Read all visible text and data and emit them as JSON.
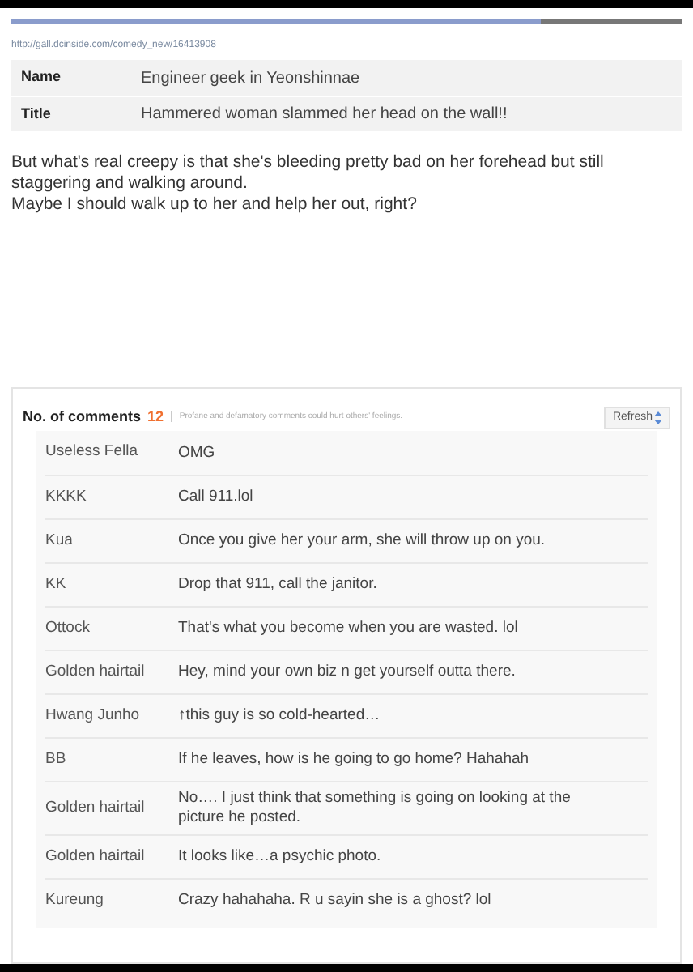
{
  "load_bar": {
    "level": 0.79
  },
  "url": "http://gall.dcinside.com/comedy_new/16413908",
  "post_info": [
    {
      "label": "Name",
      "value": "Engineer geek in Yeonshinnae"
    },
    {
      "label": "Title",
      "value": "Hammered woman slammed her head on the wall!!"
    }
  ],
  "body": [
    "But what's real creepy is that she's bleeding pretty bad on her forehead but still staggering and walking around.",
    "Maybe I should walk up to her and help her out, right?"
  ],
  "comments_header": {
    "label": "No. of comments",
    "count": "12",
    "separator": "|",
    "notice": "Profane and defamatory comments could hurt others' feelings.",
    "refresh": "Refresh"
  },
  "comments": [
    {
      "author": "Useless Fella",
      "text": "OMG"
    },
    {
      "author": "KKKK",
      "text": "Call 911.lol"
    },
    {
      "author": "Kua",
      "text": "Once you give her your arm, she will throw up on you."
    },
    {
      "author": "KK",
      "text": "Drop that 911, call the janitor."
    },
    {
      "author": "Ottock",
      "text": "That's what you become when you are wasted. lol"
    },
    {
      "author": "Golden hairtail",
      "text": "Hey, mind your own biz n get yourself outta there."
    },
    {
      "author": "Hwang Junho",
      "text": "↑this guy is so cold-hearted…"
    },
    {
      "author": "BB",
      "text": "If he leaves, how is he going to go home? Hahahah"
    },
    {
      "author": "Golden hairtail",
      "text": "No…. I just think that something is going on looking at the picture he posted."
    },
    {
      "author": "Golden hairtail",
      "text": "It looks like…a psychic photo."
    },
    {
      "author": "Kureung",
      "text": "Crazy hahahaha. R u sayin she is a ghost? lol"
    }
  ]
}
